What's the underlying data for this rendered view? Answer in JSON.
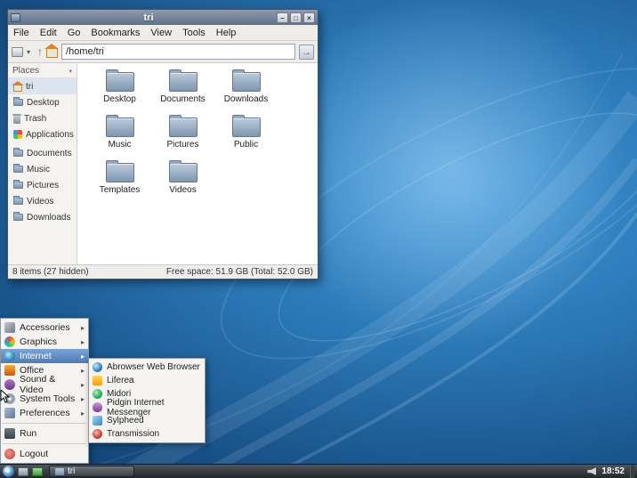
{
  "icons": {
    "caret_down": "▾",
    "up_arrow": "↑",
    "go_arrow": "→",
    "submenu_arrow": "▸",
    "minimize": "–",
    "maximize": "□",
    "close": "×"
  },
  "colors": {
    "desktop_blue": "#2e7fc0",
    "titlebar": "#6f8096",
    "menu_highlight": "#5b84b8",
    "folder": "#8ca3bb"
  },
  "window": {
    "title": "tri",
    "menubar": [
      "File",
      "Edit",
      "Go",
      "Bookmarks",
      "View",
      "Tools",
      "Help"
    ],
    "toolbar": {
      "path_value": "/home/tri"
    },
    "sidebar": {
      "header": "Places",
      "items": [
        {
          "label": "tri",
          "icon": "home-icon"
        },
        {
          "label": "Desktop",
          "icon": "folder-icon"
        },
        {
          "label": "Trash",
          "icon": "trash-icon"
        },
        {
          "label": "Applications",
          "icon": "applications-icon"
        },
        {
          "label": "Documents",
          "icon": "folder-icon"
        },
        {
          "label": "Music",
          "icon": "folder-icon"
        },
        {
          "label": "Pictures",
          "icon": "folder-icon"
        },
        {
          "label": "Videos",
          "icon": "folder-icon"
        },
        {
          "label": "Downloads",
          "icon": "folder-icon"
        }
      ]
    },
    "folders": [
      "Desktop",
      "Documents",
      "Downloads",
      "Music",
      "Pictures",
      "Public",
      "Templates",
      "Videos"
    ],
    "status": {
      "left": "8 items (27 hidden)",
      "right": "Free space: 51.9 GB (Total: 52.0 GB)"
    }
  },
  "app_menu": {
    "items": [
      {
        "label": "Accessories",
        "icon": "accessories-icon",
        "submenu": true
      },
      {
        "label": "Graphics",
        "icon": "graphics-icon",
        "submenu": true
      },
      {
        "label": "Internet",
        "icon": "internet-icon",
        "submenu": true,
        "highlighted": true
      },
      {
        "label": "Office",
        "icon": "office-icon",
        "submenu": true
      },
      {
        "label": "Sound & Video",
        "icon": "sound-video-icon",
        "submenu": true
      },
      {
        "label": "System Tools",
        "icon": "system-tools-icon",
        "submenu": true
      },
      {
        "label": "Preferences",
        "icon": "preferences-icon",
        "submenu": true
      },
      {
        "label": "Run",
        "icon": "run-icon",
        "submenu": false
      },
      {
        "label": "Logout",
        "icon": "logout-icon",
        "submenu": false
      }
    ],
    "submenu": [
      {
        "label": "Abrowser Web Browser",
        "icon": "abrowser-icon"
      },
      {
        "label": "Liferea",
        "icon": "liferea-icon"
      },
      {
        "label": "Midori",
        "icon": "midori-icon"
      },
      {
        "label": "Pidgin Internet Messenger",
        "icon": "pidgin-icon"
      },
      {
        "label": "Sylpheed",
        "icon": "sylpheed-icon"
      },
      {
        "label": "Transmission",
        "icon": "transmission-icon"
      }
    ]
  },
  "taskbar": {
    "task_label": "tri",
    "clock": "18:52"
  }
}
